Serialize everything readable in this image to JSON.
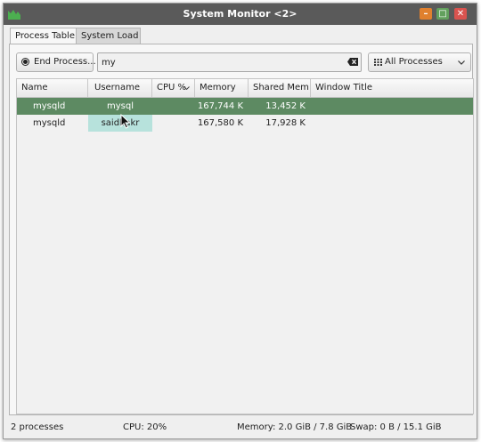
{
  "window": {
    "title": "System Monitor <2>",
    "buttons": {
      "minimize": "–",
      "maximize": "□",
      "close": "✕"
    }
  },
  "tabs": [
    {
      "label": "Process Table",
      "active": true
    },
    {
      "label": "System Load",
      "active": false
    }
  ],
  "toolbar": {
    "end_process_label": "End Process...",
    "search_value": "my",
    "filter_selected": "All Processes"
  },
  "table": {
    "columns": [
      "Name",
      "Username",
      "CPU %",
      "Memory",
      "Shared Mem",
      "Window Title"
    ],
    "sort_column": "CPU %",
    "rows": [
      {
        "name": "mysqld",
        "username": "mysql",
        "cpu": "",
        "memory": "167,744 K",
        "shared": "13,452 K",
        "window_title": "",
        "selected": true
      },
      {
        "name": "mysqld",
        "username": "saidbakr",
        "cpu": "",
        "memory": "167,580 K",
        "shared": "17,928 K",
        "window_title": "",
        "selected": false
      }
    ]
  },
  "status": {
    "processes": "2 processes",
    "cpu": "CPU: 20%",
    "memory": "Memory: 2.0 GiB / 7.8 GiB",
    "swap": "Swap: 0 B / 15.1 GiB"
  },
  "colors": {
    "titlebar": "#5a5a5a",
    "selection": "#5d8a62",
    "user_highlight": "#b7e2dc",
    "app_icon": "#4caf50"
  },
  "icons": [
    "app-icon",
    "record-icon",
    "clear-search-icon",
    "grid-icon",
    "chevron-down-icon",
    "sort-down-icon",
    "mouse-cursor-icon"
  ]
}
